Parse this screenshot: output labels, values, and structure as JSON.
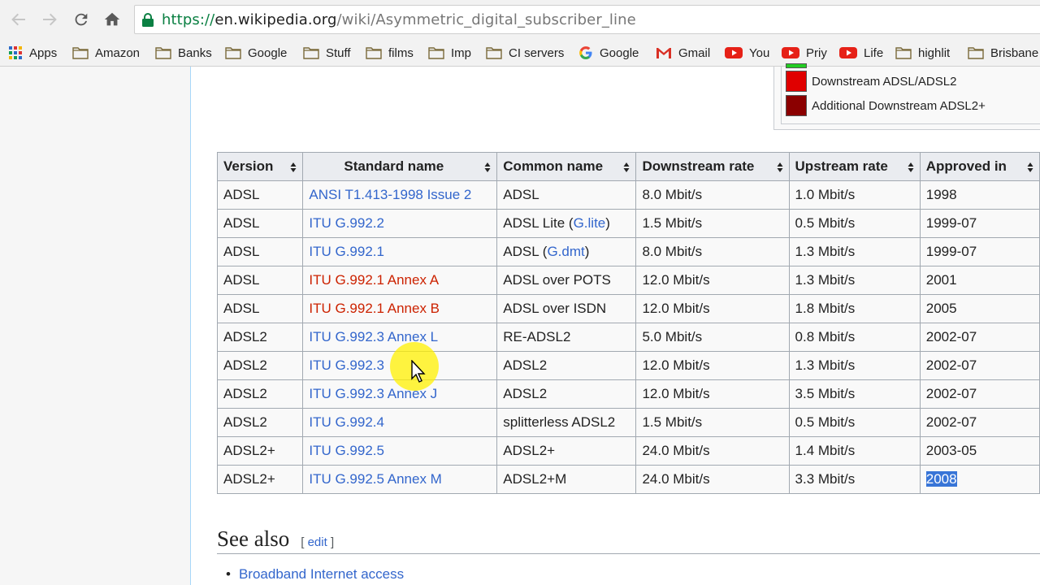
{
  "browser": {
    "url_scheme": "https://",
    "url_host": "en.wikipedia.org",
    "url_path": "/wiki/Asymmetric_digital_subscriber_line",
    "bookmarks": [
      {
        "label": "Apps",
        "icon": "apps-grid-icon"
      },
      {
        "label": "Amazon",
        "icon": "folder-icon"
      },
      {
        "label": "Banks",
        "icon": "folder-icon"
      },
      {
        "label": "Google",
        "icon": "folder-icon"
      },
      {
        "label": "Stuff",
        "icon": "folder-icon"
      },
      {
        "label": "films",
        "icon": "folder-icon"
      },
      {
        "label": "Imp",
        "icon": "folder-icon"
      },
      {
        "label": "CI servers",
        "icon": "folder-icon"
      },
      {
        "label": "Google",
        "icon": "google-g-icon"
      },
      {
        "label": "Gmail",
        "icon": "gmail-icon"
      },
      {
        "label": "You",
        "icon": "youtube-icon"
      },
      {
        "label": "Priy",
        "icon": "youtube-icon"
      },
      {
        "label": "Life",
        "icon": "youtube-icon"
      },
      {
        "label": "highlit",
        "icon": "folder-icon"
      },
      {
        "label": "Brisbane",
        "icon": "folder-icon"
      }
    ]
  },
  "legend": {
    "items": [
      {
        "label": "Downstream ADSL/ADSL2",
        "color": "#e00000"
      },
      {
        "label": "Additional Downstream ADSL2+",
        "color": "#8b0000"
      }
    ],
    "partial_color": "#22cc22"
  },
  "table": {
    "headers": [
      "Version",
      "Standard name",
      "Common name",
      "Downstream rate",
      "Upstream rate",
      "Approved in"
    ],
    "rows": [
      {
        "version": "ADSL",
        "standard": "ANSI T1.413-1998 Issue 2",
        "standard_link": "blue",
        "common": "ADSL",
        "down": "8.0 Mbit/s",
        "up": "1.0 Mbit/s",
        "approved": "1998"
      },
      {
        "version": "ADSL",
        "standard": "ITU G.992.2",
        "standard_link": "blue",
        "common": "ADSL Lite (",
        "common_link": "G.lite",
        "common_suffix": ")",
        "down": "1.5 Mbit/s",
        "up": "0.5 Mbit/s",
        "approved": "1999-07"
      },
      {
        "version": "ADSL",
        "standard": "ITU G.992.1",
        "standard_link": "blue",
        "common": "ADSL (",
        "common_link": "G.dmt",
        "common_suffix": ")",
        "down": "8.0 Mbit/s",
        "up": "1.3 Mbit/s",
        "approved": "1999-07"
      },
      {
        "version": "ADSL",
        "standard": "ITU G.992.1 Annex A",
        "standard_link": "red",
        "common": "ADSL over POTS",
        "down": "12.0 Mbit/s",
        "up": "1.3 Mbit/s",
        "approved": "2001"
      },
      {
        "version": "ADSL",
        "standard": "ITU G.992.1 Annex B",
        "standard_link": "red",
        "common": "ADSL over ISDN",
        "down": "12.0 Mbit/s",
        "up": "1.8 Mbit/s",
        "approved": "2005"
      },
      {
        "version": "ADSL2",
        "standard": "ITU G.992.3 Annex L",
        "standard_link": "blue",
        "common": "RE-ADSL2",
        "down": "5.0 Mbit/s",
        "up": "0.8 Mbit/s",
        "approved": "2002-07"
      },
      {
        "version": "ADSL2",
        "standard": "ITU G.992.3",
        "standard_link": "blue",
        "common": "ADSL2",
        "down": "12.0 Mbit/s",
        "up": "1.3 Mbit/s",
        "approved": "2002-07"
      },
      {
        "version": "ADSL2",
        "standard": "ITU G.992.3 Annex J",
        "standard_link": "blue",
        "common": "ADSL2",
        "down": "12.0 Mbit/s",
        "up": "3.5 Mbit/s",
        "approved": "2002-07"
      },
      {
        "version": "ADSL2",
        "standard": "ITU G.992.4",
        "standard_link": "blue",
        "common": "splitterless ADSL2",
        "down": "1.5 Mbit/s",
        "up": "0.5 Mbit/s",
        "approved": "2002-07"
      },
      {
        "version": "ADSL2+",
        "standard": "ITU G.992.5",
        "standard_link": "blue",
        "common": "ADSL2+",
        "down": "24.0 Mbit/s",
        "up": "1.4 Mbit/s",
        "approved": "2003-05"
      },
      {
        "version": "ADSL2+",
        "standard": "ITU G.992.5 Annex M",
        "standard_link": "blue",
        "common": "ADSL2+M",
        "down": "24.0 Mbit/s",
        "up": "3.3 Mbit/s",
        "approved": "2008",
        "approved_selected": true
      }
    ]
  },
  "see_also": {
    "heading": "See also",
    "edit_open": "[",
    "edit_label": "edit",
    "edit_close": "]",
    "items": [
      "Broadband Internet access"
    ]
  }
}
